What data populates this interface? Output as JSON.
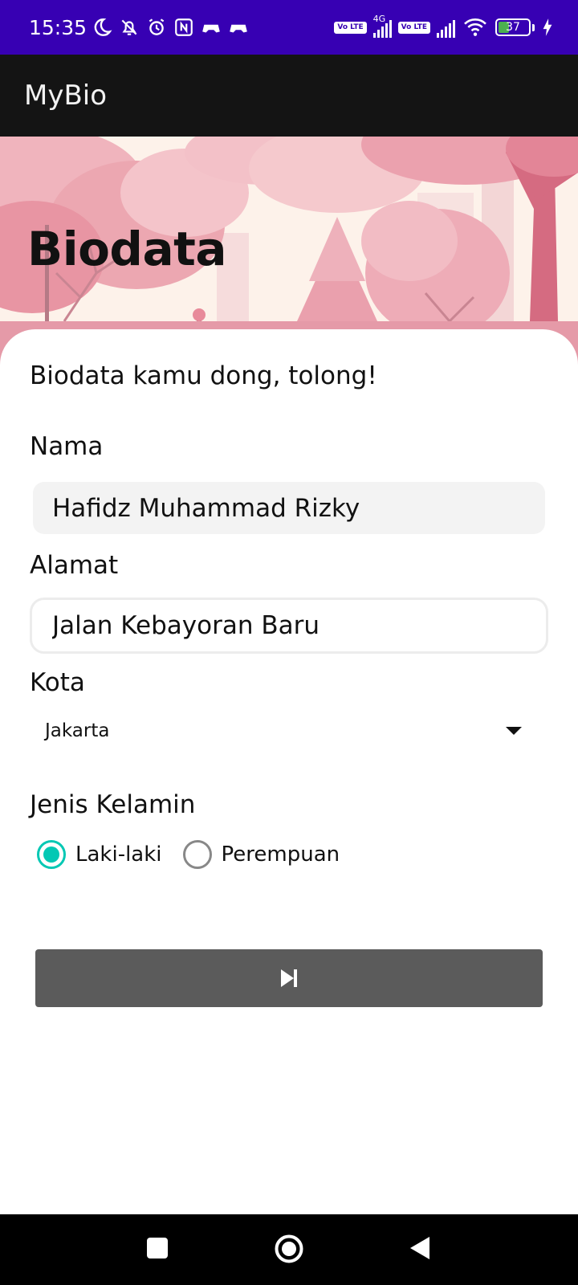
{
  "status_bar": {
    "time": "15:35",
    "left_icons": [
      "moon-icon",
      "mute-icon",
      "alarm-icon",
      "nfc-icon",
      "game-icon",
      "game-icon-2"
    ],
    "volte_1": "Vo LTE",
    "network_type": "4G",
    "volte_2": "Vo LTE",
    "battery_level": "37",
    "battery_fraction": 0.37,
    "background_color": "#3700b3"
  },
  "app_bar": {
    "title": "MyBio",
    "background_color": "#141414"
  },
  "hero": {
    "title": "Biodata",
    "palette": [
      "#fdf2ea",
      "#f4b9c2",
      "#e68a9b",
      "#d56b81"
    ]
  },
  "form": {
    "subtitle": "Biodata kamu dong, tolong!",
    "nama": {
      "label": "Nama",
      "value": "Hafidz Muhammad Rizky"
    },
    "alamat": {
      "label": "Alamat",
      "value": "Jalan Kebayoran Baru"
    },
    "kota": {
      "label": "Kota",
      "selected": "Jakarta"
    },
    "jenis_kelamin": {
      "label": "Jenis Kelamin",
      "options": [
        {
          "label": "Laki-laki",
          "checked": true
        },
        {
          "label": "Perempuan",
          "checked": false
        }
      ],
      "accent_color": "#03c8b4"
    },
    "next_button": {
      "icon": "skip-next-icon",
      "background_color": "#5b5b5b"
    }
  },
  "nav_bar": {
    "buttons": [
      "recents-square-icon",
      "home-circle-icon",
      "back-triangle-icon"
    ]
  }
}
